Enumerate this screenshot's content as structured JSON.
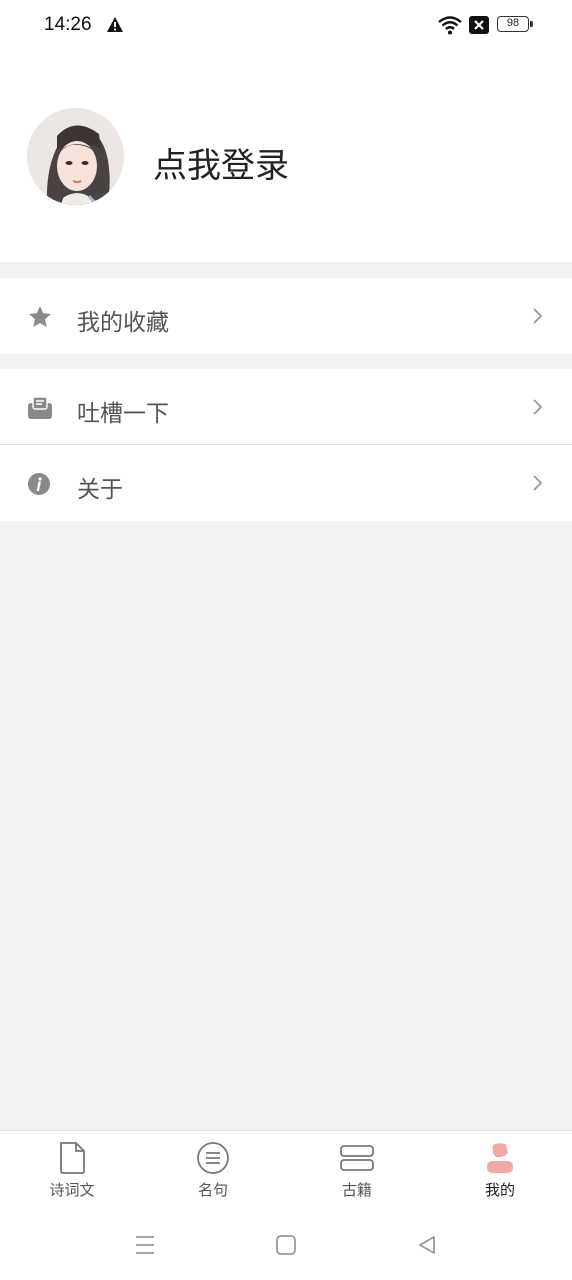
{
  "status_bar": {
    "time": "14:26",
    "battery": "98"
  },
  "profile": {
    "login_label": "点我登录"
  },
  "menu": {
    "favorites": "我的收藏",
    "feedback": "吐槽一下",
    "about": "关于"
  },
  "tabs": [
    {
      "label": "诗词文",
      "icon": "document-icon"
    },
    {
      "label": "名句",
      "icon": "list-circle-icon"
    },
    {
      "label": "古籍",
      "icon": "books-icon"
    },
    {
      "label": "我的",
      "icon": "person-icon",
      "active": true
    }
  ],
  "colors": {
    "accent": "#f0a8a8",
    "background": "#f2f2f2",
    "icon_gray": "#8a8a8a"
  }
}
